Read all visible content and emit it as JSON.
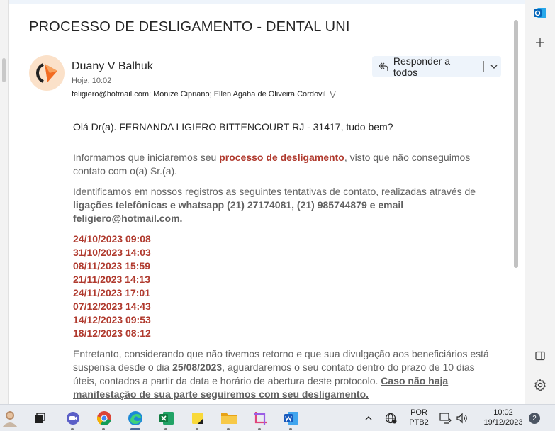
{
  "email": {
    "subject": "PROCESSO DE DESLIGAMENTO - DENTAL UNI",
    "sender_name": "Duany V Balhuk",
    "sent_time": "Hoje, 10:02",
    "recipients": "feligiero@hotmail.com; Monize Cipriano; Ellen Agaha de Oliveira Cordovil",
    "reply_all_label": "Responder a todos",
    "greeting": "Olá Dr(a). FERNANDA LIGIERO BITTENCOURT RJ - 31417, tudo bem?",
    "p1_a": "Informamos que iniciaremos seu ",
    "p1_b": "processo de desligamento",
    "p1_c": ", visto que não conseguimos contato com o(a) Sr.(a).",
    "p2_a": "Identificamos em nossos registros as seguintes tentativas de contato, realizadas através de ",
    "p2_b": "ligações telefônicas e whatsapp  (21) 27174081, (21) 985744879 e email feligiero@hotmail.com.",
    "dates": [
      "24/10/2023 09:08",
      "31/10/2023 14:03",
      "08/11/2023 15:59",
      "21/11/2023 14:13",
      "24/11/2023 17:01",
      "07/12/2023 14:43",
      "14/12/2023 09:53",
      "18/12/2023 08:12"
    ],
    "p3_a": "Entretanto, considerando que não tivemos retorno e que sua divulgação aos beneficiários está suspensa desde o dia ",
    "p3_b": "25/08/2023",
    "p3_c": ", aguardaremos o seu contato dentro do prazo de 10 dias úteis, contados a partir da data e horário de abertura deste protocolo. ",
    "p3_d": "Caso não haja manifestação de sua parte seguiremos com seu desligamento."
  },
  "taskbar": {
    "lang_1": "POR",
    "lang_2": "PTB2",
    "time": "10:02",
    "date": "19/12/2023",
    "notification_count": "2"
  },
  "colors": {
    "accent_red": "#b03a2e",
    "reply_bg": "#eef4fb",
    "avatar_bg": "#fbe1c9",
    "avatar_orange": "#f26b21"
  }
}
